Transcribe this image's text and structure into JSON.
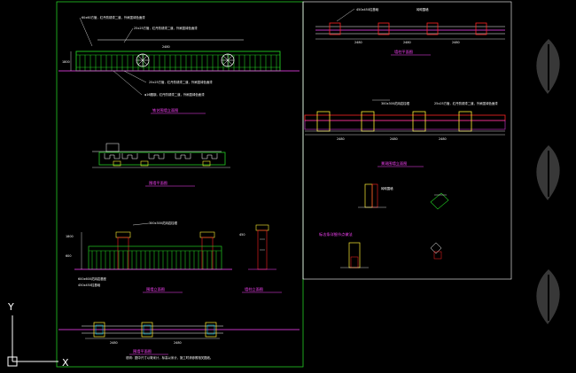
{
  "drawing": {
    "background": "#000000",
    "frame_color": "#22cc22",
    "accent_magenta": "#ff44ff",
    "accent_cyan": "#00e5ff",
    "accent_yellow": "#ffee33",
    "accent_red": "#ff2222"
  },
  "ucs": {
    "y_label": "Y",
    "x_label": "X"
  },
  "sheet_titles": {
    "fence_elevation": "铁艺围墙立面图",
    "fence_plan": "围墙平面图",
    "pillar_elevation": "墙柱立面图",
    "wall_elevation": "围墙立面图",
    "wall_plan": "围墙平面图",
    "detail_a": "墙柱平面图",
    "detail_b": "景观围墙立面图",
    "node_detail": "标志条详细节点做法"
  },
  "annotations": {
    "top_note_1": "60x60方管，红丹防锈漆二道，外刷墨绿色面漆",
    "top_note_2": "25x25方管，红丹防锈漆二道，外刷墨绿色面漆",
    "side_note_1": "25x25方管，红丹防锈漆二道，外刷墨绿色面漆",
    "side_note_2": "φ16圆钢，红丹防锈漆二道，外刷墨绿色面漆",
    "cap_note": "300x300花岗岩柱帽",
    "base_note": "600x600花岗岩基座",
    "plan_note_1": "450x450柱基础",
    "plan_note_2": "砖砌围墙",
    "bottom_note": "说明：图中尺寸以毫米计，标高以米计，施工时请参照相关图纸。"
  },
  "dims": {
    "span_1": "2480",
    "span_2": "2480",
    "span_3": "2480",
    "span_4": "2480",
    "height_1": "1800",
    "height_2": "600",
    "pillar_w": "450"
  },
  "watermark": {
    "icon": "feather-logo-icon"
  }
}
